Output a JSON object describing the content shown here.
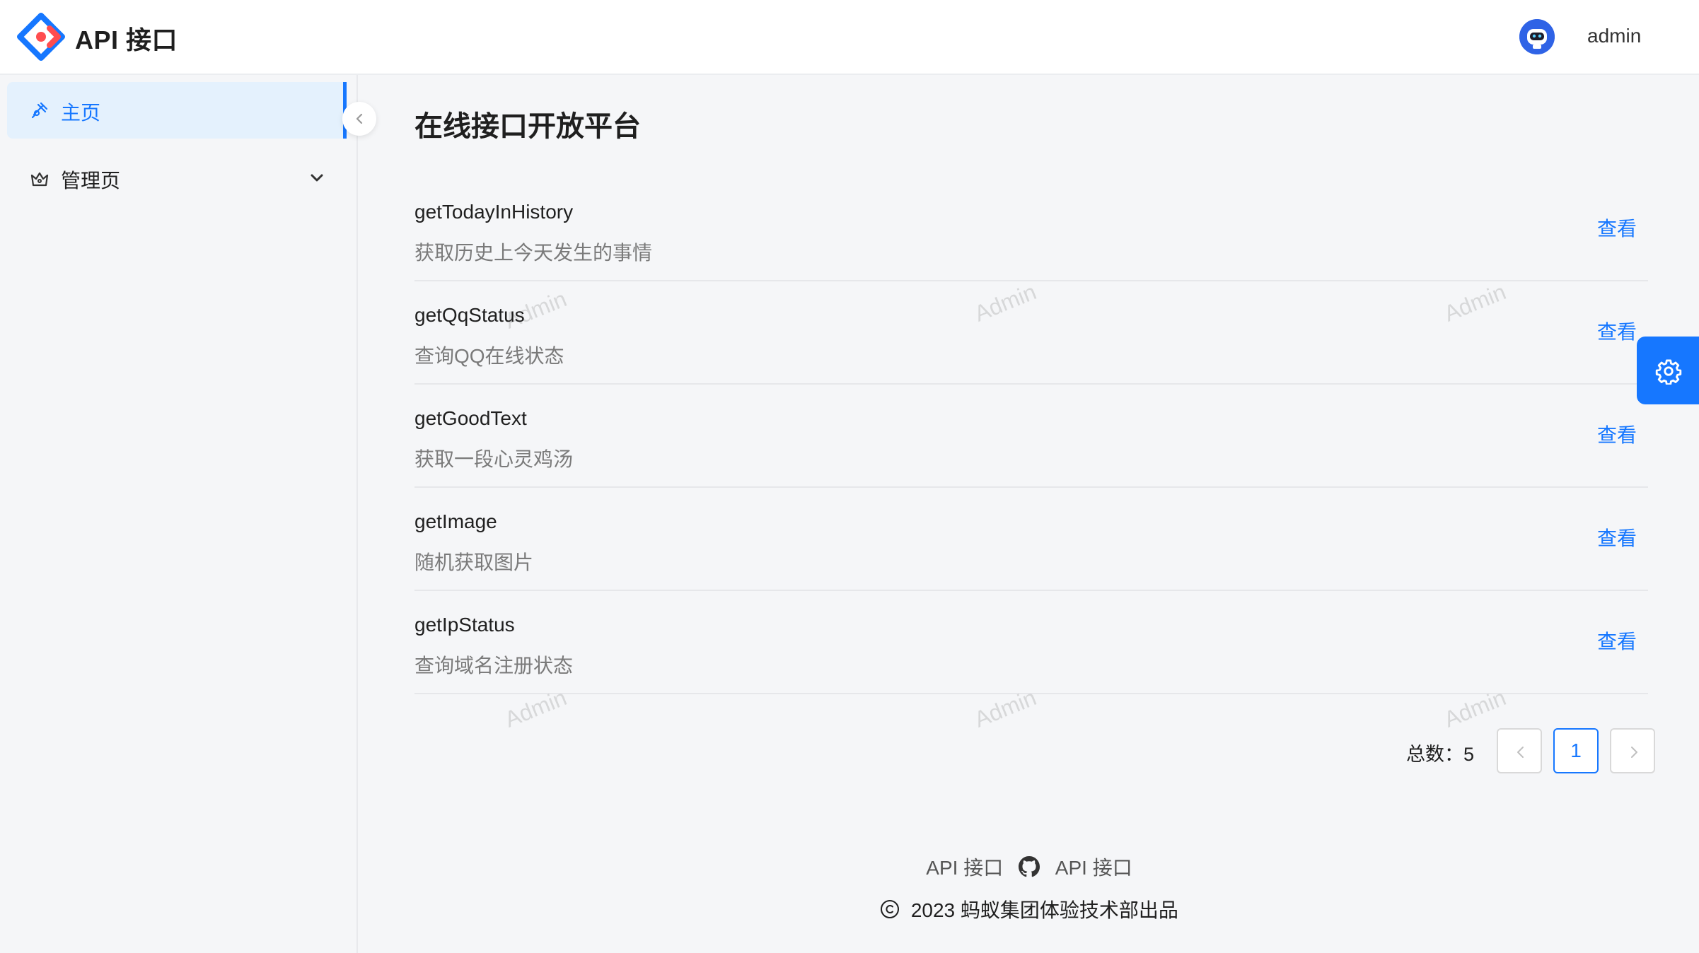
{
  "header": {
    "app_title": "API 接口",
    "username": "admin"
  },
  "sidebar": {
    "items": [
      {
        "label": "主页",
        "icon": "smile-icon"
      },
      {
        "label": "管理页",
        "icon": "crown-icon"
      }
    ]
  },
  "main": {
    "title": "在线接口开放平台",
    "view_label": "查看",
    "apis": [
      {
        "name": "getTodayInHistory",
        "description": "获取历史上今天发生的事情"
      },
      {
        "name": "getQqStatus",
        "description": "查询QQ在线状态"
      },
      {
        "name": "getGoodText",
        "description": "获取一段心灵鸡汤"
      },
      {
        "name": "getImage",
        "description": "随机获取图片"
      },
      {
        "name": "getIpStatus",
        "description": "查询域名注册状态"
      }
    ]
  },
  "pagination": {
    "total_label": "总数：5",
    "current_page": "1"
  },
  "footer": {
    "link1": "API 接口",
    "link2": "API 接口",
    "copyright": "2023 蚂蚁集团体验技术部出品"
  },
  "watermark": "Admin",
  "colors": {
    "primary": "#1677ff",
    "active_bg": "#e4f1fd"
  }
}
